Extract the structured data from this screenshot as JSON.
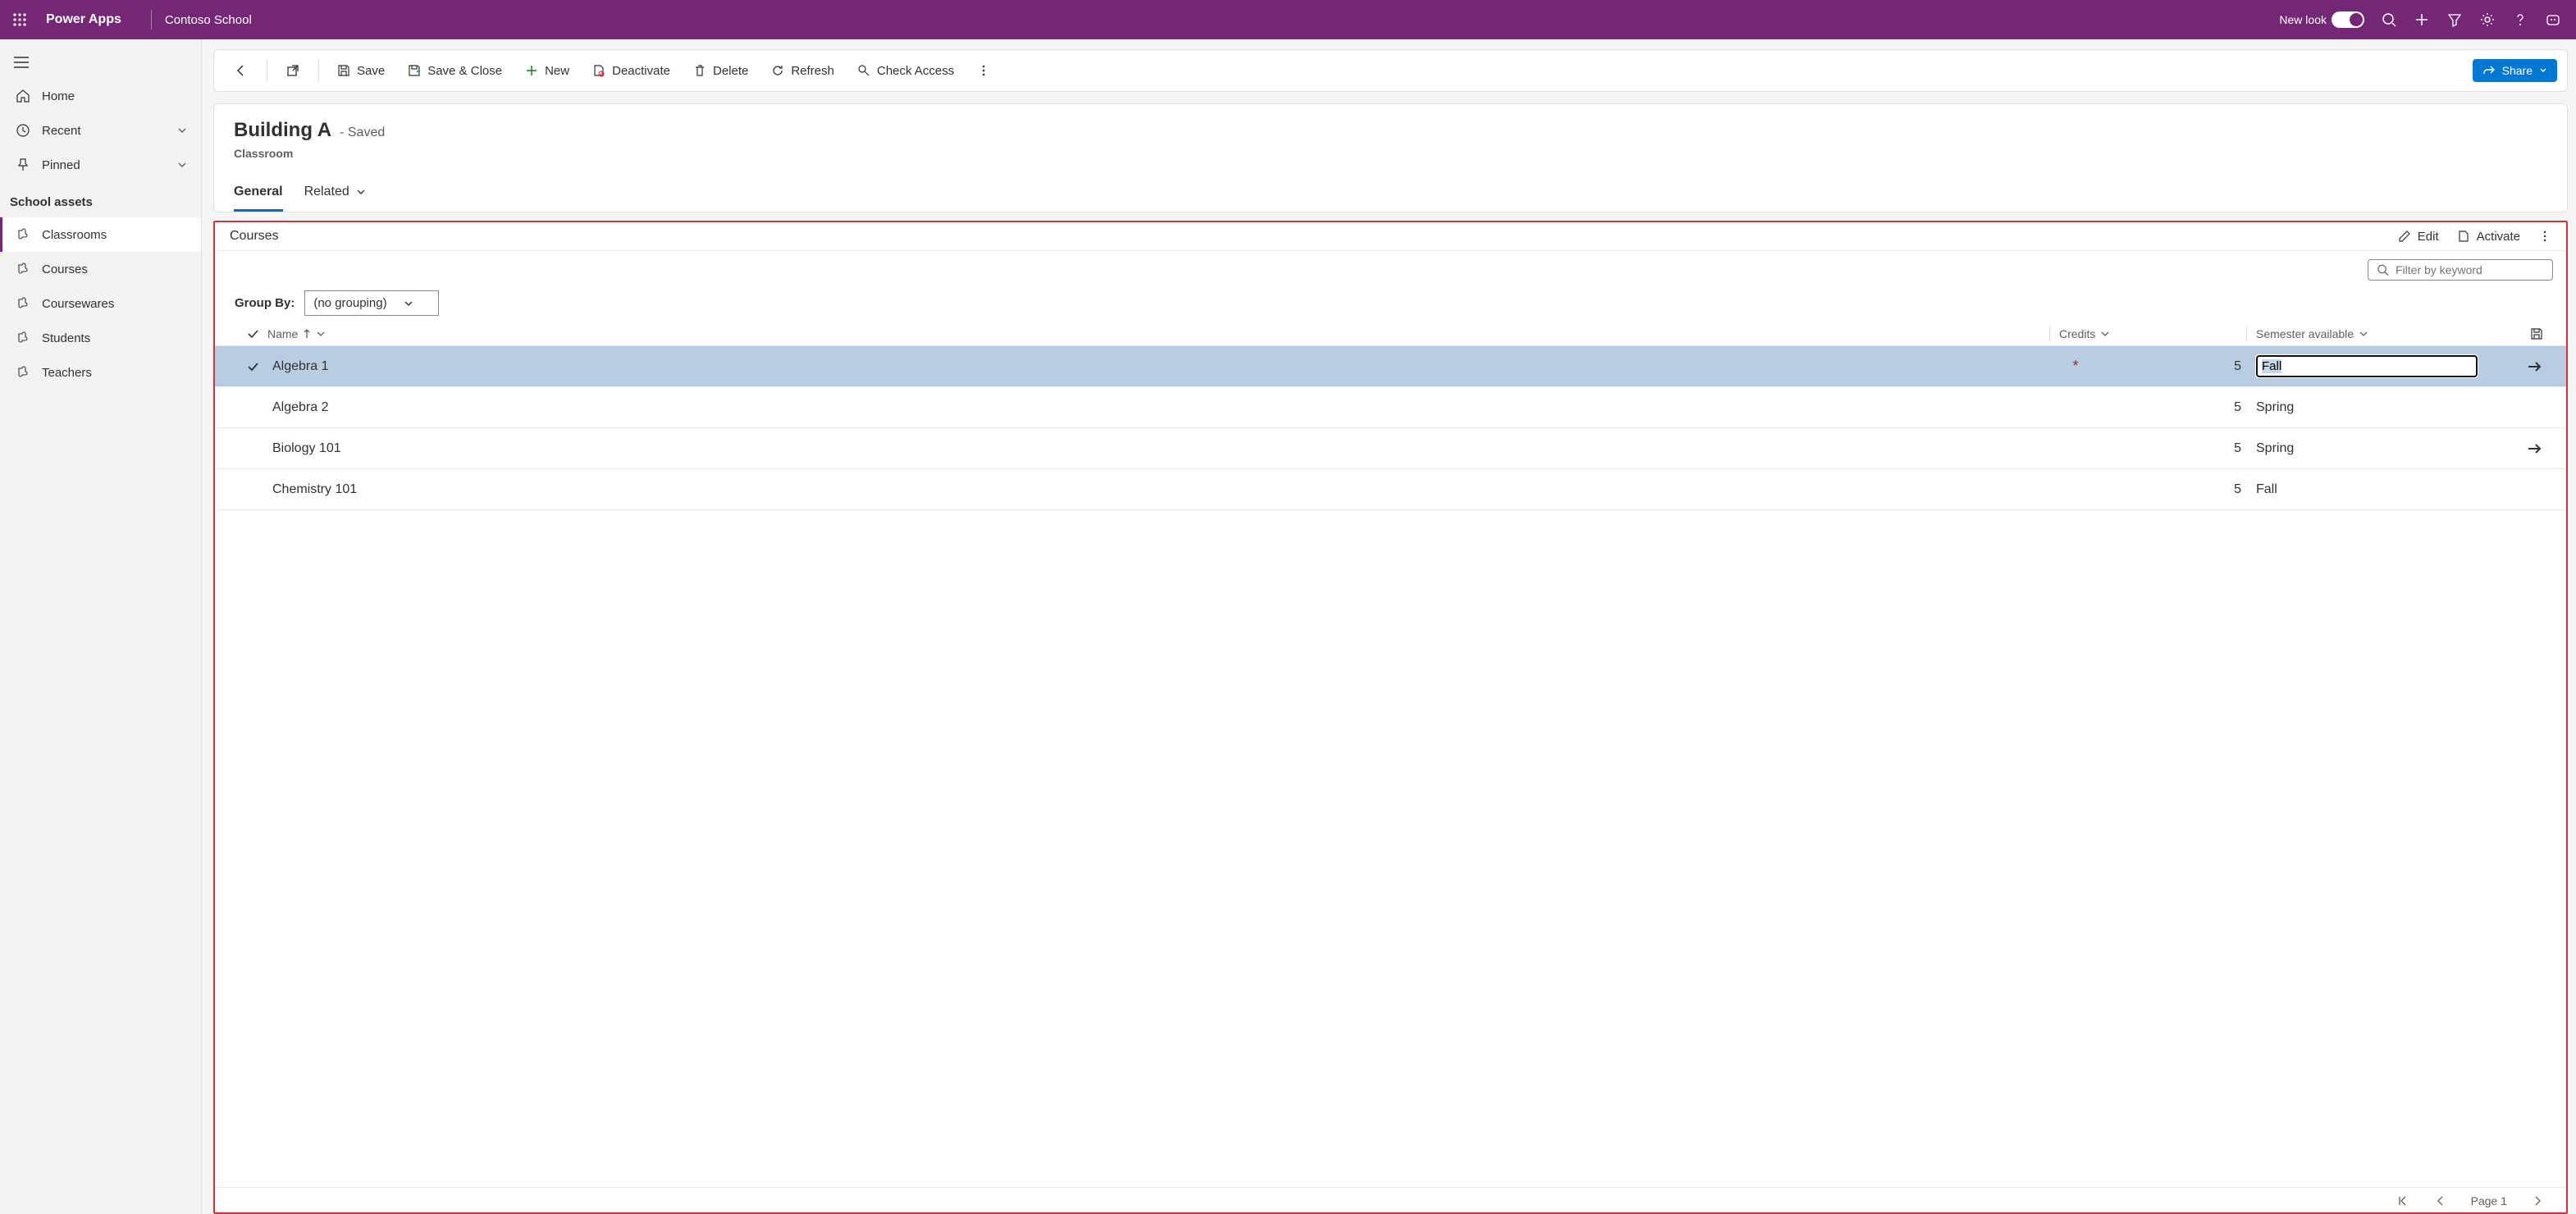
{
  "header": {
    "brand": "Power Apps",
    "org": "Contoso School",
    "new_look_label": "New look"
  },
  "sidebar": {
    "home": "Home",
    "recent": "Recent",
    "pinned": "Pinned",
    "group_label": "School assets",
    "items": [
      {
        "label": "Classrooms"
      },
      {
        "label": "Courses"
      },
      {
        "label": "Coursewares"
      },
      {
        "label": "Students"
      },
      {
        "label": "Teachers"
      }
    ]
  },
  "commands": {
    "save": "Save",
    "save_close": "Save & Close",
    "new": "New",
    "deactivate": "Deactivate",
    "delete": "Delete",
    "refresh": "Refresh",
    "check_access": "Check Access",
    "share": "Share"
  },
  "record": {
    "title": "Building A",
    "status": "- Saved",
    "entity": "Classroom",
    "tabs": {
      "general": "General",
      "related": "Related"
    }
  },
  "subgrid": {
    "title": "Courses",
    "edit": "Edit",
    "activate": "Activate",
    "filter_placeholder": "Filter by keyword",
    "groupby_label": "Group By:",
    "groupby_value": "(no grouping)",
    "columns": {
      "name": "Name",
      "credits": "Credits",
      "sem": "Semester available"
    },
    "rows": [
      {
        "name": "Algebra 1",
        "credits": "5",
        "sem": "Fall",
        "selected": true,
        "editing": true,
        "required": true,
        "arrow": true
      },
      {
        "name": "Algebra 2",
        "credits": "5",
        "sem": "Spring",
        "selected": false,
        "editing": false,
        "required": false,
        "arrow": false
      },
      {
        "name": "Biology 101",
        "credits": "5",
        "sem": "Spring",
        "selected": false,
        "editing": false,
        "required": false,
        "arrow": true
      },
      {
        "name": "Chemistry 101",
        "credits": "5",
        "sem": "Fall",
        "selected": false,
        "editing": false,
        "required": false,
        "arrow": false
      }
    ],
    "page_label": "Page 1"
  }
}
